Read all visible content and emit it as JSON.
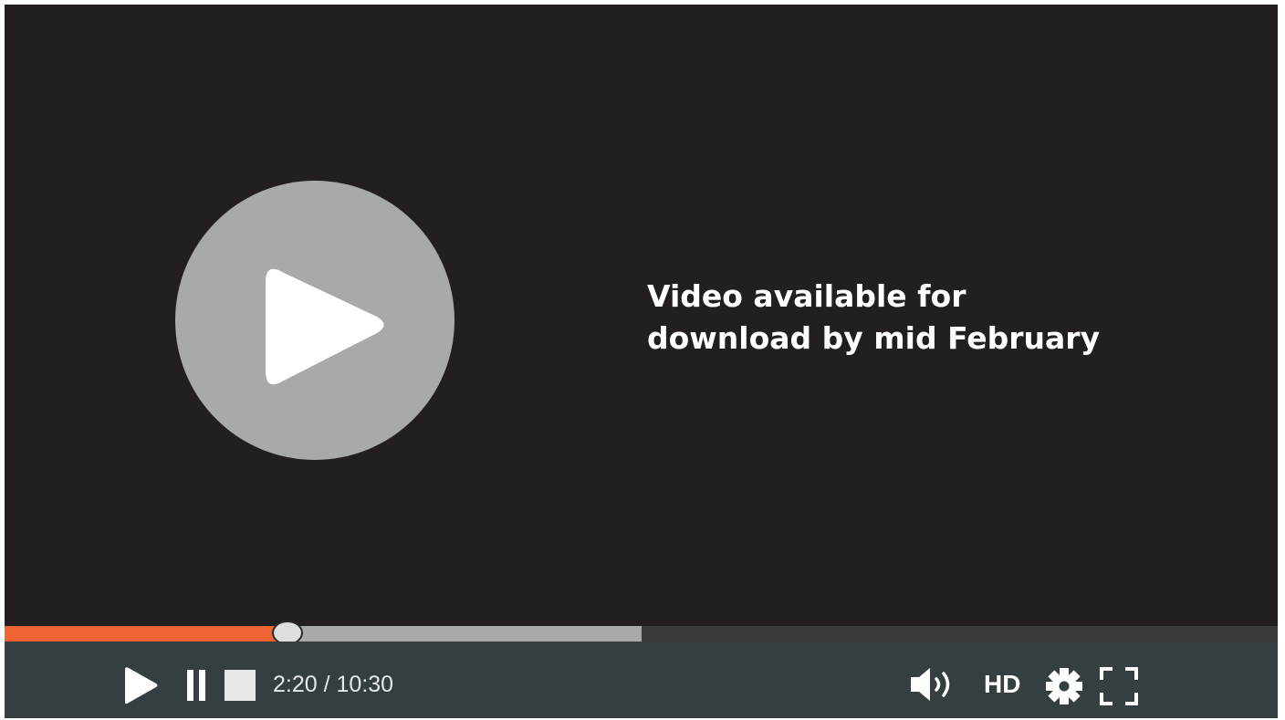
{
  "colors": {
    "video_background": "#231f20",
    "control_bar": "#353e40",
    "progress_played": "#ef6433",
    "progress_buffered": "#a7a9aa",
    "progress_track": "#393b3c",
    "big_play_circle": "#a7a9aa"
  },
  "message": {
    "line1": "Video available for",
    "line2": "download by mid February"
  },
  "playback": {
    "current_time": "2:20",
    "separator": " / ",
    "duration": "10:30",
    "played_fraction": 0.2222,
    "buffered_fraction": 0.5
  },
  "controls": {
    "quality_label": "HD",
    "icons": [
      "play-icon",
      "pause-icon",
      "stop-icon",
      "volume-icon",
      "settings-gear-icon",
      "fullscreen-icon"
    ]
  }
}
